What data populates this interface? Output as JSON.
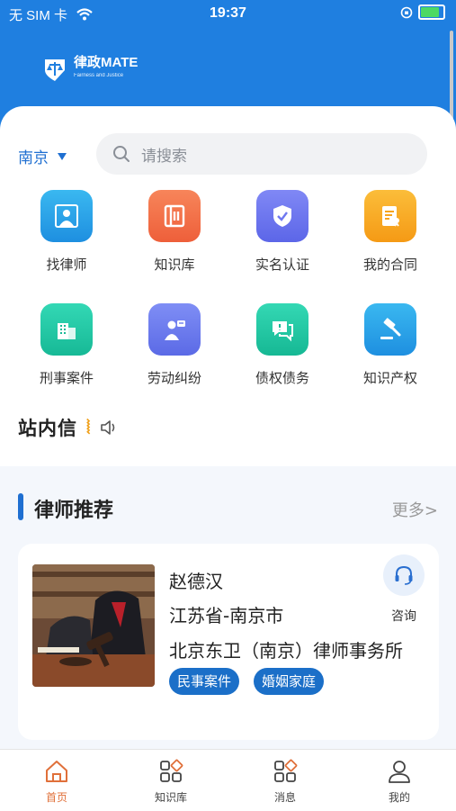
{
  "status_bar": {
    "carrier": "无 SIM 卡",
    "time": "19:37",
    "battery_level": 0.75
  },
  "brand": {
    "name": "律政MATE",
    "slogan": "Fairness and Justice"
  },
  "location": {
    "city": "南京"
  },
  "search": {
    "placeholder": "请搜索"
  },
  "features": [
    {
      "label": "找律师",
      "icon": "lawyer-icon",
      "color": "#2aa7e8"
    },
    {
      "label": "知识库",
      "icon": "book-icon",
      "color": "#f0683f"
    },
    {
      "label": "实名认证",
      "icon": "verified-badge-icon",
      "color": "#6f78f0"
    },
    {
      "label": "我的合同",
      "icon": "contract-icon",
      "color": "#f7a51e"
    },
    {
      "label": "刑事案件",
      "icon": "building-icon",
      "color": "#1fc9a6"
    },
    {
      "label": "劳动纠纷",
      "icon": "worker-icon",
      "color": "#6c7cf0"
    },
    {
      "label": "债权债务",
      "icon": "chat-bubble-icon",
      "color": "#1fc7a3"
    },
    {
      "label": "知识产权",
      "icon": "gavel-icon",
      "color": "#2aa7e8"
    }
  ],
  "notice": {
    "title": "站内信"
  },
  "recommend": {
    "title": "律师推荐",
    "more": "更多>",
    "lawyer": {
      "name": "赵德汉",
      "location": "江苏省-南京市",
      "firm": "北京东卫（南京）律师事务所",
      "tags": [
        "民事案件",
        "婚姻家庭"
      ],
      "consult": "咨询"
    }
  },
  "tabs": [
    {
      "label": "首页",
      "icon": "home-icon",
      "active": true
    },
    {
      "label": "知识库",
      "icon": "grid-icon",
      "active": false
    },
    {
      "label": "消息",
      "icon": "message-grid-icon",
      "active": false
    },
    {
      "label": "我的",
      "icon": "profile-icon",
      "active": false
    }
  ]
}
